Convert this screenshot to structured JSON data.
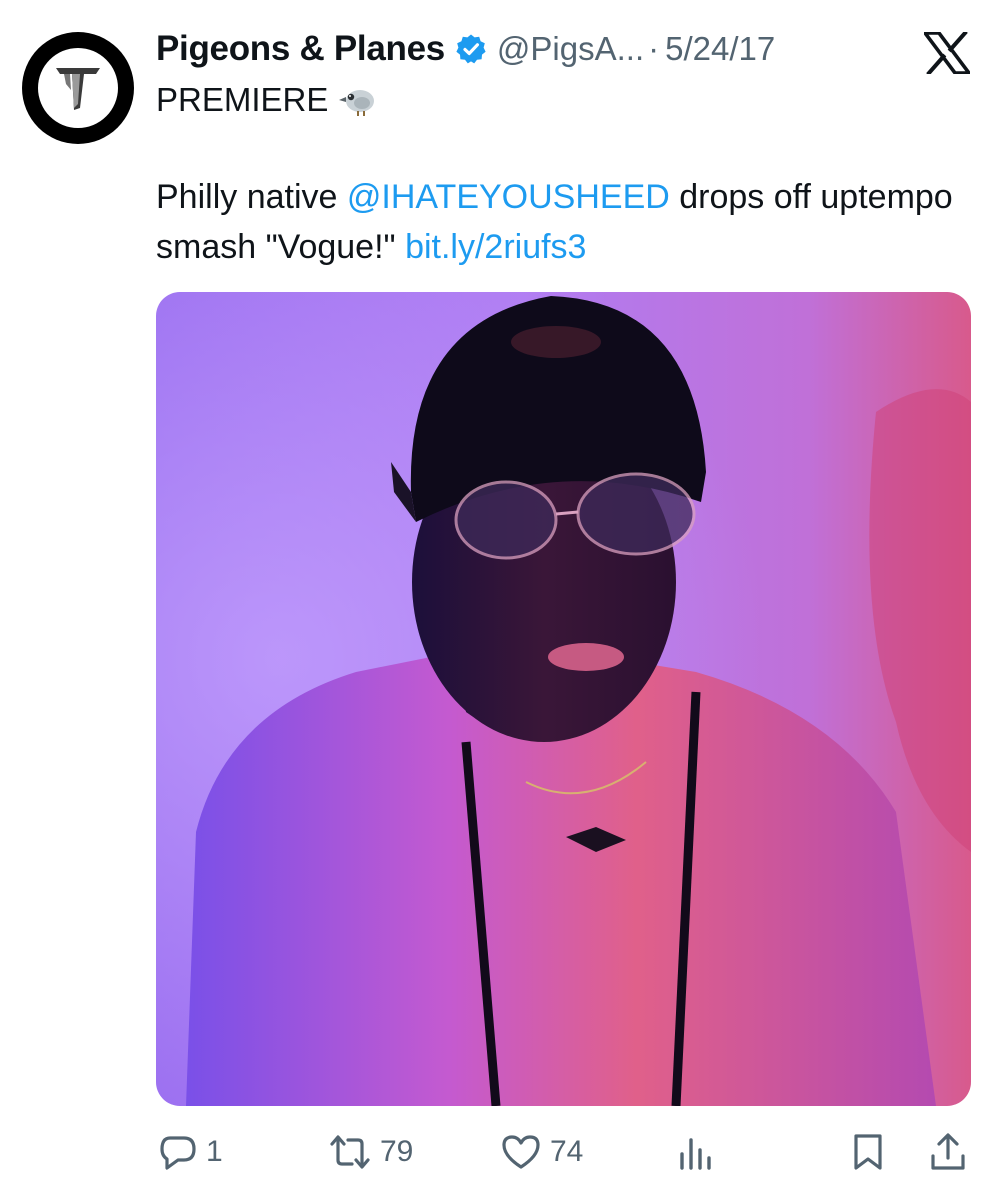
{
  "tweet": {
    "display_name": "Pigeons & Planes",
    "handle": "@PigsA...",
    "separator": "·",
    "date": "5/24/17",
    "first_line": "PREMIERE",
    "body": {
      "prefix": "Philly native ",
      "mention": "@IHATEYOUSHEED",
      "middle": " drops off uptempo smash \"Vogue!\" ",
      "link": "bit.ly/2riufs3"
    },
    "image_alt": "Man wearing a black cap and round glasses under pink and blue light"
  },
  "actions": {
    "replies": "1",
    "reposts": "79",
    "likes": "74"
  },
  "icons": {
    "verified": "verified-badge-icon",
    "platform": "x-logo-icon",
    "emoji": "bird-emoji-icon",
    "reply": "reply-icon",
    "repost": "repost-icon",
    "like": "heart-icon",
    "views": "views-icon",
    "bookmark": "bookmark-icon",
    "share": "share-icon"
  },
  "colors": {
    "link": "#1d9bf0",
    "secondary_text": "#536471",
    "primary_text": "#0f1419",
    "verified": "#1d9bf0"
  }
}
